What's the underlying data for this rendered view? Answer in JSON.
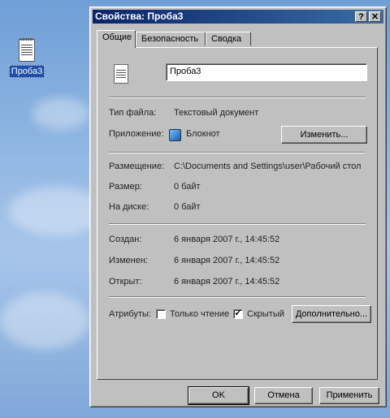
{
  "desktop": {
    "icon_label": "Проба3",
    "icon_name": "text-document-icon"
  },
  "dialog": {
    "title": "Свойства: Проба3",
    "help_button": "?",
    "close_button": "✕",
    "tabs": [
      "Общие",
      "Безопасность",
      "Сводка"
    ],
    "file_name": "Проба3",
    "type_label": "Тип файла:",
    "type_value": "Текстовый документ",
    "app_label": "Приложение:",
    "app_value": "Блокнот",
    "change_button": "Изменить...",
    "location_label": "Размещение:",
    "location_value": "C:\\Documents and Settings\\user\\Рабочий стол",
    "size_label": "Размер:",
    "size_value": "0 байт",
    "disk_label": "На диске:",
    "disk_value": "0 байт",
    "created_label": "Создан:",
    "created_value": "6 января 2007 г., 14:45:52",
    "modified_label": "Изменен:",
    "modified_value": "6 января 2007 г., 14:45:52",
    "opened_label": "Открыт:",
    "opened_value": "6 января 2007 г., 14:45:52",
    "attributes_label": "Атрибуты:",
    "readonly_label": "Только чтение",
    "readonly_checked": false,
    "hidden_label": "Скрытый",
    "hidden_checked": true,
    "advanced_button": "Дополнительно...",
    "ok_button": "OK",
    "cancel_button": "Отмена",
    "apply_button": "Применить",
    "check_mark": "✓"
  },
  "colors": {
    "titlebar_start": "#0a246a",
    "titlebar_end": "#3a6ea5",
    "window_face": "#c0c0c0"
  }
}
